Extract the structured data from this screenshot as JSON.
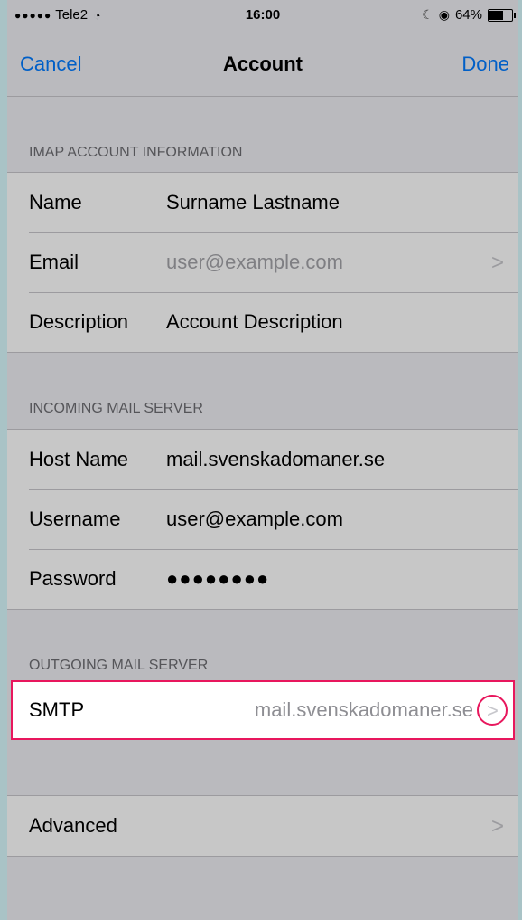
{
  "status": {
    "carrier": "Tele2",
    "time": "16:00",
    "battery": "64%",
    "battery_level": 0.64
  },
  "nav": {
    "cancel": "Cancel",
    "title": "Account",
    "done": "Done"
  },
  "sections": {
    "imap": {
      "header": "IMAP ACCOUNT INFORMATION",
      "rows": [
        {
          "label": "Name",
          "value": "Surname Lastname"
        },
        {
          "label": "Email",
          "value": "user@example.com"
        },
        {
          "label": "Description",
          "value": "Account Description"
        }
      ]
    },
    "incoming": {
      "header": "INCOMING MAIL SERVER",
      "rows": [
        {
          "label": "Host Name",
          "value": "mail.svenskadomaner.se"
        },
        {
          "label": "Username",
          "value": "user@example.com"
        },
        {
          "label": "Password",
          "value": "●●●●●●●●"
        }
      ]
    },
    "outgoing": {
      "header": "OUTGOING MAIL SERVER",
      "smtp": {
        "label": "SMTP",
        "value": "mail.svenskadomaner.se"
      }
    },
    "advanced": {
      "label": "Advanced"
    }
  },
  "colors": {
    "accent": "#007aff",
    "highlight": "#e8175d"
  }
}
